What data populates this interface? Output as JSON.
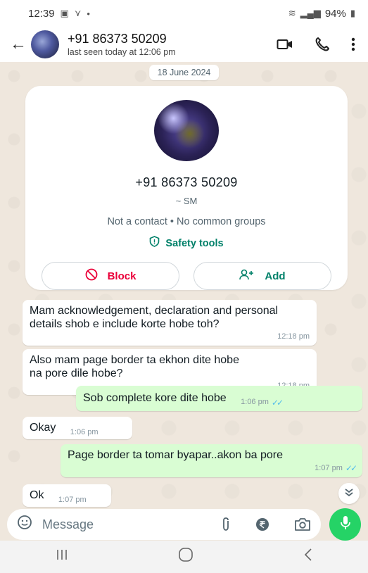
{
  "status_bar": {
    "time": "12:39",
    "battery": "94%"
  },
  "header": {
    "contact_name": "+91 86373 50209",
    "last_seen": "last seen today at 12:06 pm"
  },
  "chat": {
    "date_chip": "18 June 2024",
    "contact_card": {
      "phone": "+91 86373 50209",
      "alias": "~ SM",
      "info": "Not a contact • No common groups",
      "safety_tools": "Safety tools",
      "block_label": "Block",
      "add_label": "Add"
    },
    "messages": [
      {
        "direction": "in",
        "text": "Mam acknowledgement, declaration and personal details shob e include korte hobe toh?",
        "time": "12:18 pm"
      },
      {
        "direction": "in",
        "text": "Also mam page border ta ekhon dite hobe na pore dile hobe?",
        "time": "12:18 pm"
      },
      {
        "direction": "out",
        "text": "Sob complete kore dite hobe",
        "time": "1:06 pm",
        "read": true
      },
      {
        "direction": "in",
        "text": "Okay",
        "time": "1:06 pm"
      },
      {
        "direction": "out",
        "text": "Page border ta tomar byapar..akon ba pore",
        "time": "1:07 pm",
        "read": true
      },
      {
        "direction": "in",
        "text": "Ok",
        "time": "1:07 pm"
      }
    ]
  },
  "composer": {
    "placeholder": "Message"
  },
  "colors": {
    "accent": "#008069",
    "outgoing_bubble": "#d9fdd3",
    "mic_button": "#25d366",
    "block_red": "#ea0038",
    "read_tick": "#53bdeb"
  }
}
